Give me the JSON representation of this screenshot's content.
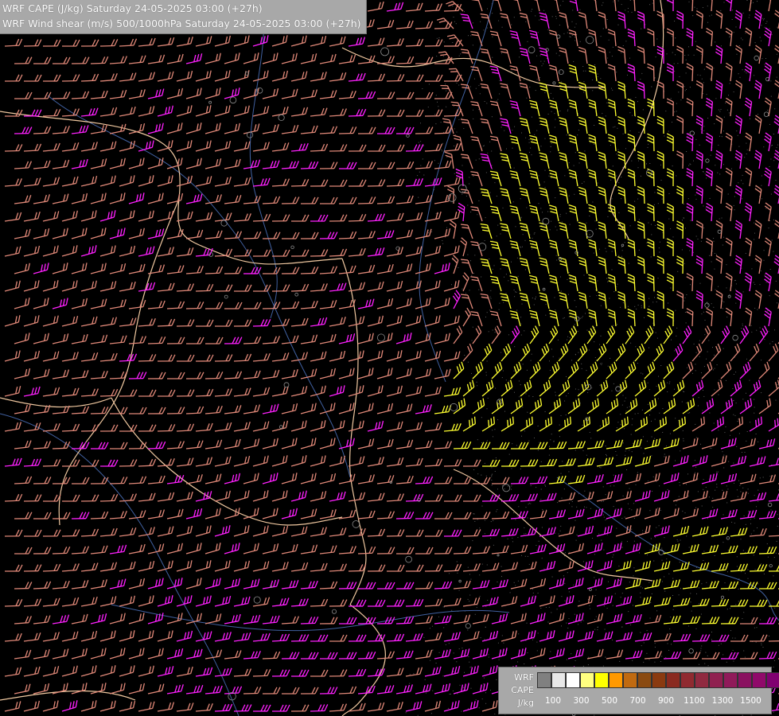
{
  "header": {
    "line1": "WRF CAPE (J/kg) Saturday 24-05-2025 03:00 (+27h)",
    "line2": "WRF Wind shear (m/s) 500/1000hPa Saturday 24-05-2025 03:00 (+27h)"
  },
  "legend": {
    "label_top": "WRF",
    "label_mid": "CAPE",
    "label_unit": "J/kg",
    "swatch_colors": [
      "#808080",
      "#e8e8e8",
      "#ffffff",
      "#ffff80",
      "#ffff00",
      "#ff9900",
      "#c06a10",
      "#8a4a10",
      "#8a3a10",
      "#8a2a20",
      "#902a30",
      "#902a40",
      "#902050",
      "#901a5a",
      "#8a1060",
      "#900a6a",
      "#800070",
      "#900080"
    ],
    "ticks": [
      "100",
      "300",
      "500",
      "700",
      "900",
      "1100",
      "1300",
      "1500"
    ]
  },
  "barb_colors": {
    "salmon": "#e08878",
    "magenta": "#ff20ff",
    "yellow": "#ffff30",
    "orange": "#f0a070"
  },
  "map_colors": {
    "border": "#f0c8a0",
    "river": "#4060a0",
    "coast": "#c0c0c0"
  }
}
